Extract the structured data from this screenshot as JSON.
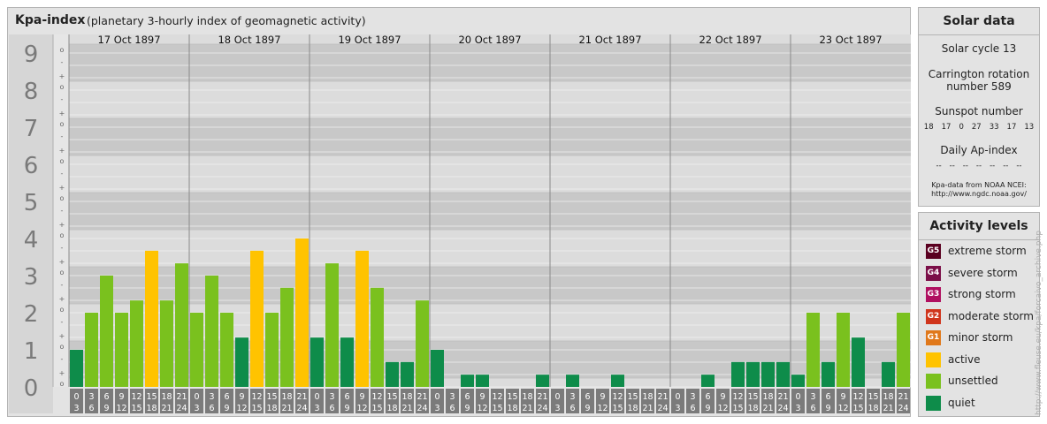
{
  "header": {
    "title": "Kpa-index",
    "subtitle": "(planetary 3-hourly index of geomagnetic activity)"
  },
  "chart_data": {
    "type": "bar",
    "title": "Kpa-index",
    "subtitle": "(planetary 3-hourly index of geomagnetic activity)",
    "ylim": [
      0,
      9
    ],
    "y_ticks": [
      "0",
      "1",
      "2",
      "3",
      "4",
      "5",
      "6",
      "7",
      "8",
      "9"
    ],
    "sub_ticks": [
      "o",
      "+",
      "-"
    ],
    "days": [
      "17 Oct 1897",
      "18 Oct 1897",
      "19 Oct 1897",
      "20 Oct 1897",
      "21 Oct 1897",
      "22 Oct 1897",
      "23 Oct 1897"
    ],
    "interval_labels": [
      [
        "0",
        "3"
      ],
      [
        "3",
        "6"
      ],
      [
        "6",
        "9"
      ],
      [
        "9",
        "12"
      ],
      [
        "12",
        "15"
      ],
      [
        "15",
        "18"
      ],
      [
        "18",
        "21"
      ],
      [
        "21",
        "24"
      ]
    ],
    "values": [
      [
        1.0,
        2.0,
        3.0,
        2.0,
        2.33,
        3.67,
        2.33,
        3.33
      ],
      [
        2.0,
        3.0,
        2.0,
        1.33,
        3.67,
        2.0,
        2.67,
        4.0
      ],
      [
        1.33,
        3.33,
        1.33,
        3.67,
        2.67,
        0.67,
        0.67,
        2.33
      ],
      [
        1.0,
        0.0,
        0.33,
        0.33,
        0.0,
        0.0,
        0.0,
        0.33
      ],
      [
        0.0,
        0.33,
        0.0,
        0.0,
        0.33,
        0.0,
        0.0,
        0.0
      ],
      [
        0.0,
        0.0,
        0.33,
        0.0,
        0.67,
        0.67,
        0.67,
        0.67
      ],
      [
        0.33,
        2.0,
        0.67,
        2.0,
        1.33,
        0.0,
        0.67,
        2.0
      ]
    ],
    "grid": true,
    "colors": {
      "quiet": "#0e8c4a",
      "unsettled": "#7ac11e",
      "active": "#ffc300",
      "band_dark": "#c8c8c8",
      "band_light": "#dcdcdc",
      "label_box": "#7b7b7b"
    }
  },
  "solar": {
    "title": "Solar data",
    "cycle": "Solar cycle 13",
    "carrington_line1": "Carrington rotation",
    "carrington_line2": "number 589",
    "sunspot_title": "Sunspot number",
    "sunspot_values": [
      "18",
      "17",
      "0",
      "27",
      "33",
      "17",
      "13"
    ],
    "ap_title": "Daily Ap-index",
    "ap_values": [
      "--",
      "--",
      "--",
      "--",
      "--",
      "--",
      "--"
    ],
    "source_line1": "Kpa-data from NOAA NCEI:",
    "source_line2": "http://www.ngdc.noaa.gov/"
  },
  "levels": {
    "title": "Activity levels",
    "items": [
      {
        "code": "G5",
        "label": "extreme storm",
        "color": "#5a0020"
      },
      {
        "code": "G4",
        "label": "severe storm",
        "color": "#7b0f48"
      },
      {
        "code": "G3",
        "label": "strong storm",
        "color": "#b01060"
      },
      {
        "code": "G2",
        "label": "moderate storm",
        "color": "#d0351c"
      },
      {
        "code": "G1",
        "label": "minor storm",
        "color": "#e0781a"
      },
      {
        "code": "",
        "label": "active",
        "color": "#ffc300"
      },
      {
        "code": "",
        "label": "unsettled",
        "color": "#7ac11e"
      },
      {
        "code": "",
        "label": "quiet",
        "color": "#0e8c4a"
      }
    ]
  },
  "credit": "http://www.fleuse.eu/kpa/forcaivo_archive.php"
}
